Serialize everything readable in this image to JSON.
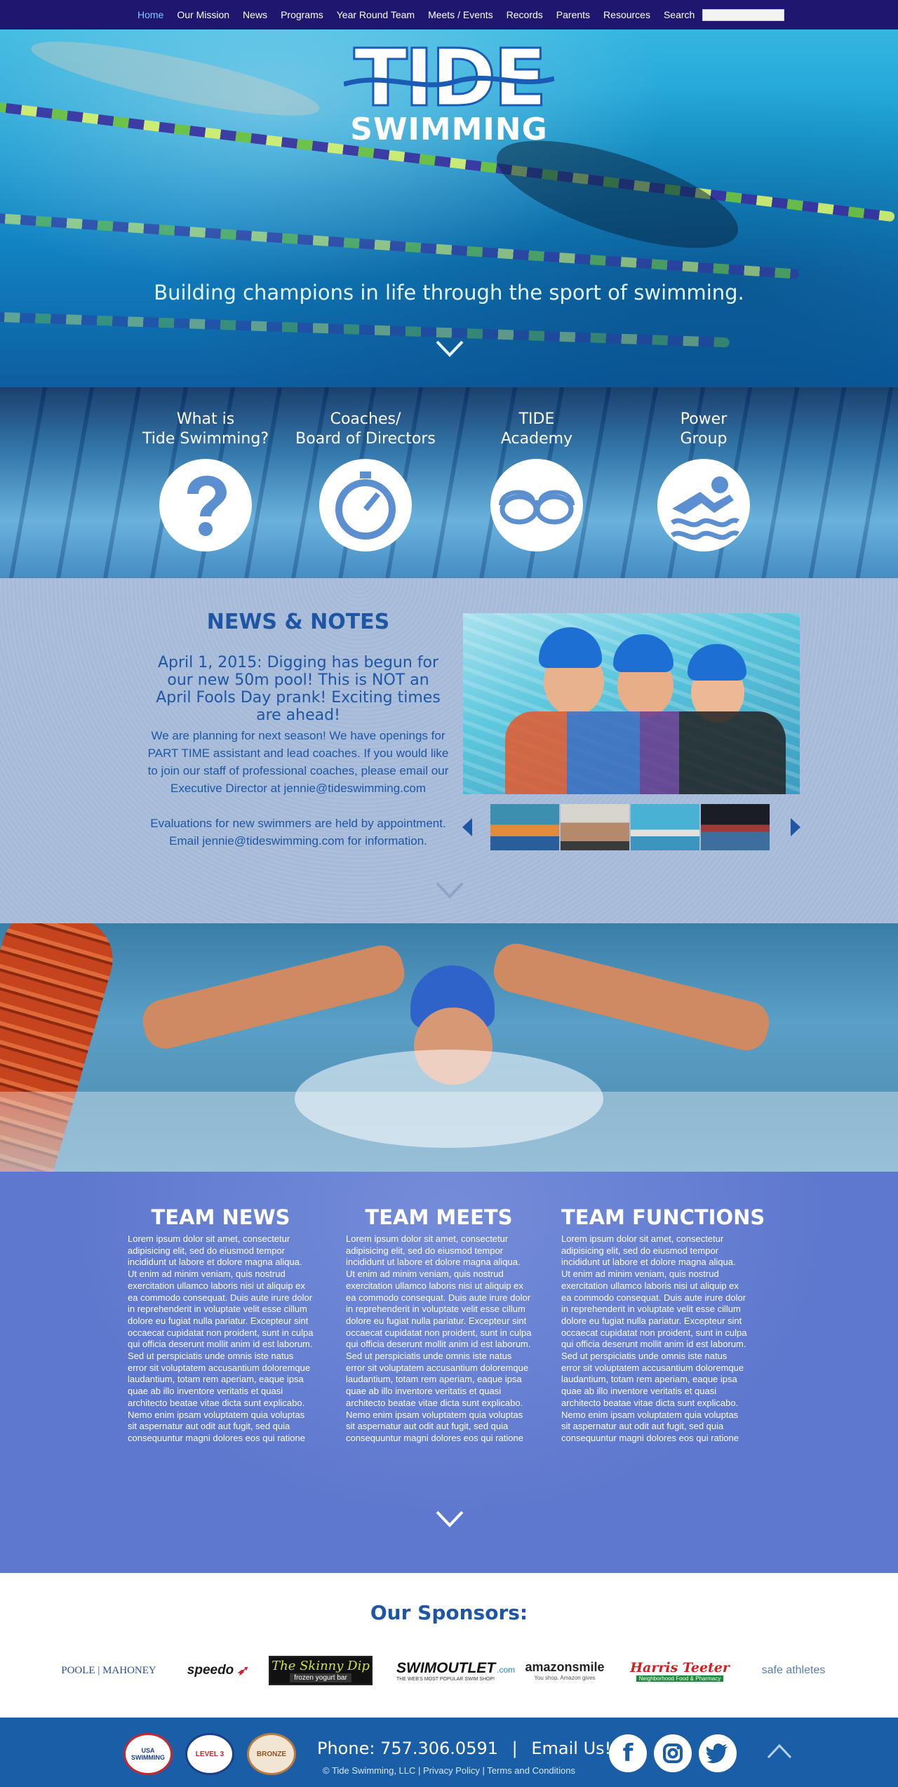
{
  "nav": {
    "items": [
      "Home",
      "Our Mission",
      "News",
      "Programs",
      "Year Round Team",
      "Meets / Events",
      "Records",
      "Parents",
      "Resources",
      "Search"
    ]
  },
  "hero": {
    "logo_top": "TIDE",
    "logo_bottom": "SWIMMING",
    "tagline": "Building champions in life through the sport of swimming."
  },
  "programs": [
    {
      "label": "What is\nTide Swimming?",
      "icon": "question-icon"
    },
    {
      "label": "Coaches/\nBoard of Directors",
      "icon": "stopwatch-icon"
    },
    {
      "label": "TIDE\nAcademy",
      "icon": "goggles-icon"
    },
    {
      "label": "Power\nGroup",
      "icon": "swimmer-icon"
    }
  ],
  "news": {
    "title": "NEWS & NOTES",
    "headline": "April 1, 2015: Digging has begun for our new 50m pool! This is NOT an April Fools Day prank! Exciting times are ahead!",
    "body1": "We are planning for next season! We have openings for PART TIME assistant and lead coaches. If you would like to join our staff of professional coaches, please email our Executive Director at jennie@tideswimming.com",
    "body2": "Evaluations for new swimmers are held by appointment. Email jennie@tideswimming.com for information."
  },
  "team": [
    {
      "title": "TEAM NEWS",
      "text": "Lorem ipsum dolor sit amet, consectetur adipisicing elit, sed do eiusmod tempor incididunt ut labore et dolore magna aliqua. Ut enim ad minim veniam, quis nostrud exercitation ullamco laboris nisi ut aliquip ex ea commodo consequat. Duis aute irure dolor in reprehenderit in voluptate velit esse cillum dolore eu fugiat nulla pariatur. Excepteur sint occaecat cupidatat non proident, sunt in culpa qui officia deserunt mollit anim id est laborum. Sed ut perspiciatis unde omnis iste natus error sit voluptatem accusantium doloremque laudantium, totam rem aperiam, eaque ipsa quae ab illo inventore veritatis et quasi architecto beatae vitae dicta sunt explicabo. Nemo enim ipsam voluptatem quia voluptas sit aspernatur aut odit aut fugit, sed quia consequuntur magni dolores eos qui ratione"
    },
    {
      "title": "TEAM MEETS",
      "text": "Lorem ipsum dolor sit amet, consectetur adipisicing elit, sed do eiusmod tempor incididunt ut labore et dolore magna aliqua. Ut enim ad minim veniam, quis nostrud exercitation ullamco laboris nisi ut aliquip ex ea commodo consequat. Duis aute irure dolor in reprehenderit in voluptate velit esse cillum dolore eu fugiat nulla pariatur. Excepteur sint occaecat cupidatat non proident, sunt in culpa qui officia deserunt mollit anim id est laborum. Sed ut perspiciatis unde omnis iste natus error sit voluptatem accusantium doloremque laudantium, totam rem aperiam, eaque ipsa quae ab illo inventore veritatis et quasi architecto beatae vitae dicta sunt explicabo. Nemo enim ipsam voluptatem quia voluptas sit aspernatur aut odit aut fugit, sed quia consequuntur magni dolores eos qui ratione"
    },
    {
      "title": "TEAM FUNCTIONS",
      "text": "Lorem ipsum dolor sit amet, consectetur adipisicing elit, sed do eiusmod tempor incididunt ut labore et dolore magna aliqua. Ut enim ad minim veniam, quis nostrud exercitation ullamco laboris nisi ut aliquip ex ea commodo consequat. Duis aute irure dolor in reprehenderit in voluptate velit esse cillum dolore eu fugiat nulla pariatur. Excepteur sint occaecat cupidatat non proident, sunt in culpa qui officia deserunt mollit anim id est laborum. Sed ut perspiciatis unde omnis iste natus error sit voluptatem accusantium doloremque laudantium, totam rem aperiam, eaque ipsa quae ab illo inventore veritatis et quasi architecto beatae vitae dicta sunt explicabo. Nemo enim ipsam voluptatem quia voluptas sit aspernatur aut odit aut fugit, sed quia consequuntur magni dolores eos qui ratione"
    }
  ],
  "sponsors": {
    "title": "Our Sponsors:",
    "logos": [
      "POOLE | MAHONEY",
      "speedo",
      "The Skinny Dip",
      "frozen yogurt bar",
      "SWIMOUTLET",
      ".com",
      "THE WEB'S MOST POPULAR SWIM SHOP!",
      "amazonsmile",
      "You shop. Amazon gives",
      "Harris Teeter",
      "Neighborhood Food & Pharmacy",
      "safe athletes"
    ]
  },
  "footer": {
    "phone": "Phone: 757.306.0591",
    "sep": "|",
    "email": "Email Us!",
    "copyright": "© Tide Swimming, LLC | Privacy Policy | Terms and Conditions",
    "badges": [
      "USA SWIMMING",
      "LEVEL 3",
      "BRONZE"
    ]
  },
  "colors": {
    "nav_bg": "#1f16 70",
    "accent": "#1f56a3",
    "team_bg": "#5e78cf",
    "footer_bg": "#1a5ea8"
  }
}
